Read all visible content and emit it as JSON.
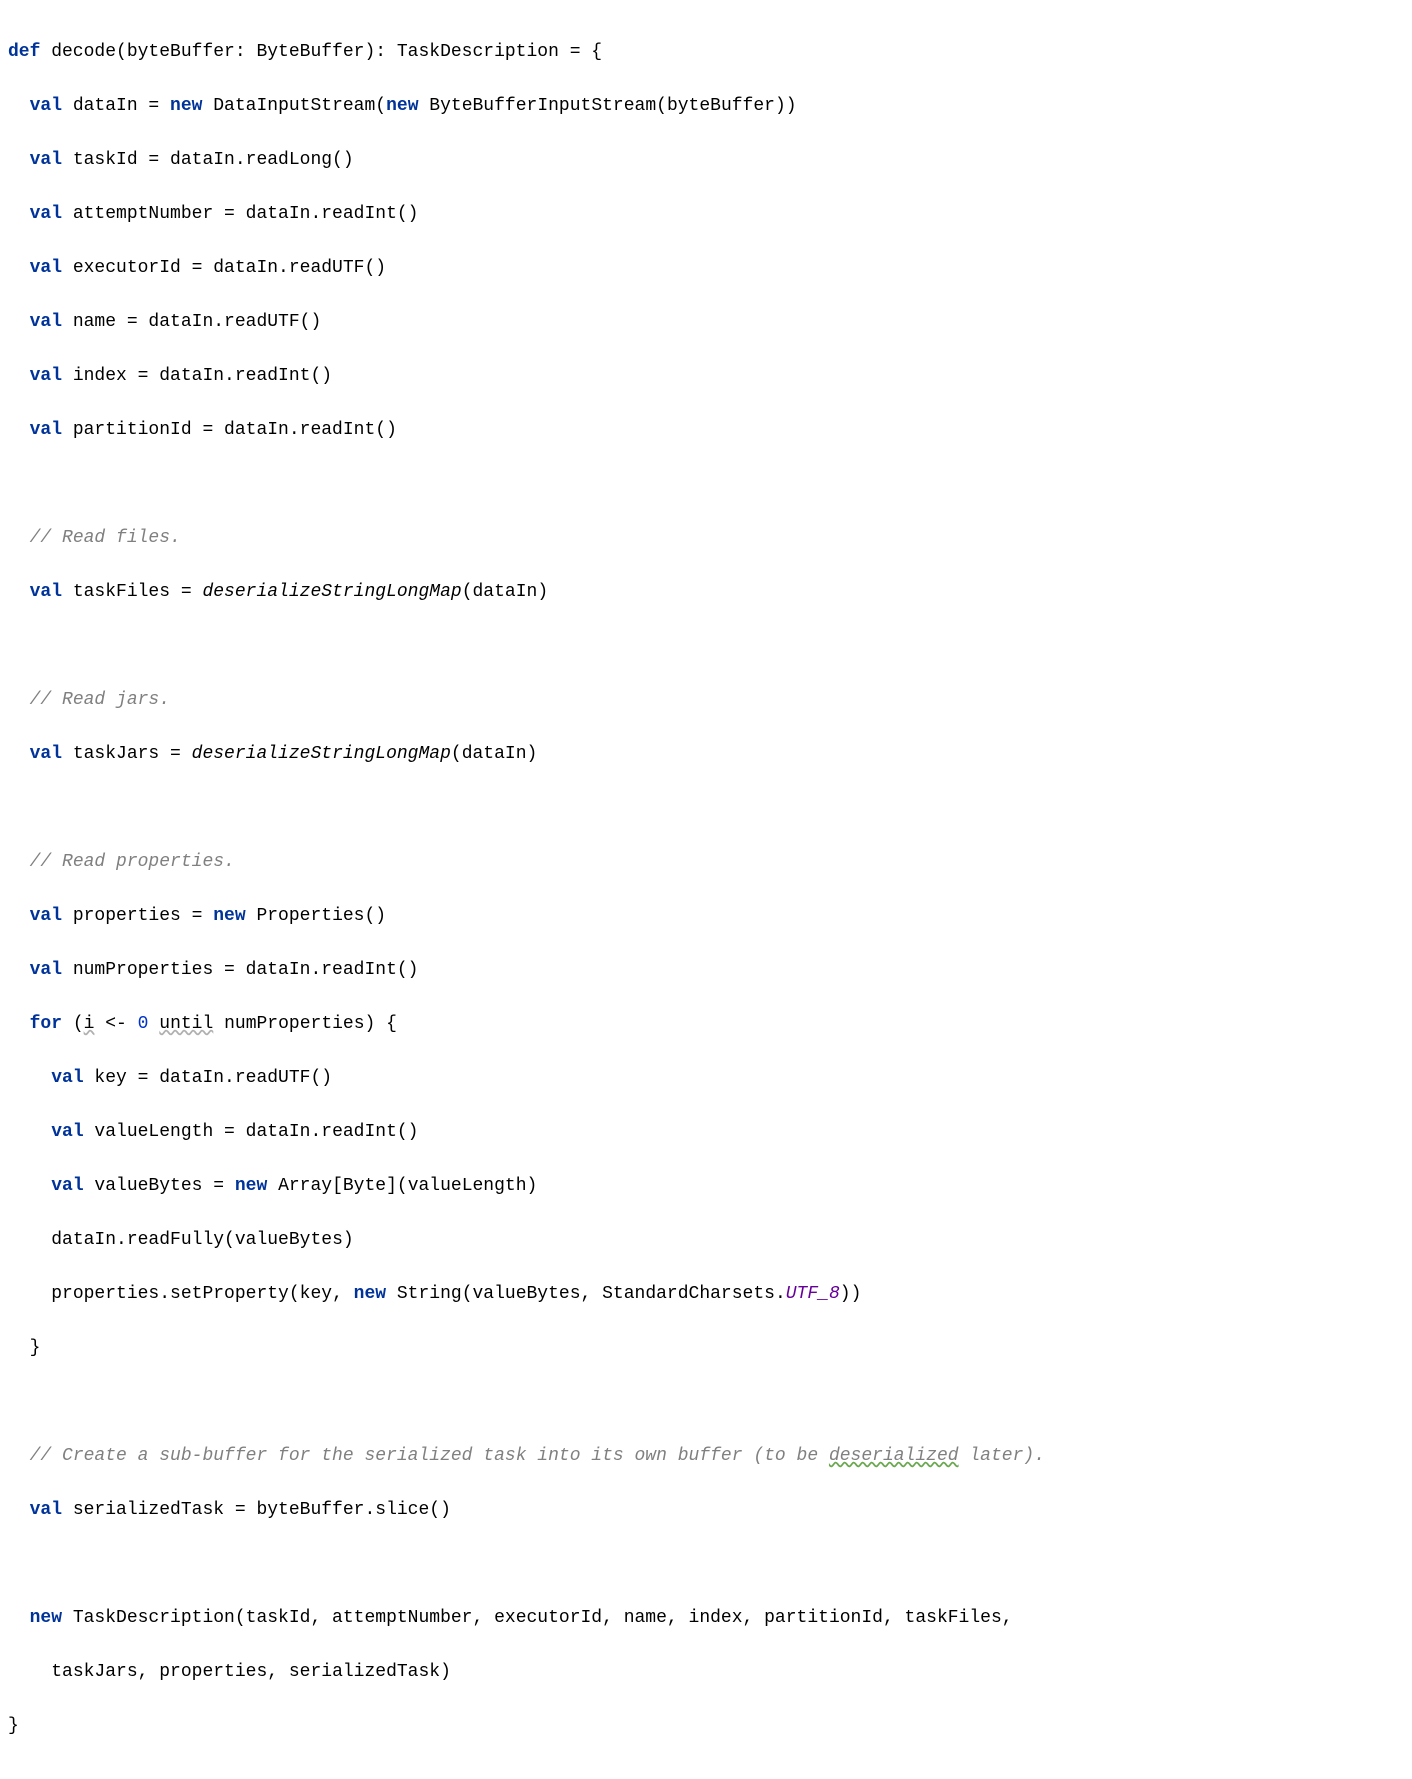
{
  "code": {
    "l01_def": "def",
    "l01_rest": " decode(byteBuffer: ByteBuffer): TaskDescription = {",
    "l02_val": "val",
    "l02_a": " dataIn = ",
    "l02_new1": "new",
    "l02_b": " DataInputStream(",
    "l02_new2": "new",
    "l02_c": " ByteBufferInputStream(byteBuffer))",
    "l03_val": "val",
    "l03_rest": " taskId = dataIn.readLong()",
    "l04_val": "val",
    "l04_rest": " attemptNumber = dataIn.readInt()",
    "l05_val": "val",
    "l05_rest": " executorId = dataIn.readUTF()",
    "l06_val": "val",
    "l06_rest": " name = dataIn.readUTF()",
    "l07_val": "val",
    "l07_rest": " index = dataIn.readInt()",
    "l08_val": "val",
    "l08_rest": " partitionId = dataIn.readInt()",
    "l10_comment": "// Read files.",
    "l11_val": "val",
    "l11_a": " taskFiles = ",
    "l11_call": "deserializeStringLongMap",
    "l11_b": "(dataIn)",
    "l13_comment": "// Read jars.",
    "l14_val": "val",
    "l14_a": " taskJars = ",
    "l14_call": "deserializeStringLongMap",
    "l14_b": "(dataIn)",
    "l16_comment": "// Read properties.",
    "l17_val": "val",
    "l17_a": " properties = ",
    "l17_new": "new",
    "l17_b": " Properties()",
    "l18_val": "val",
    "l18_rest": " numProperties = dataIn.readInt()",
    "l19_for": "for",
    "l19_a": " (",
    "l19_i": "i",
    "l19_b": " <- ",
    "l19_zero": "0",
    "l19_c": " ",
    "l19_until": "until",
    "l19_d": " numProperties) {",
    "l20_val": "val",
    "l20_rest": " key = dataIn.readUTF()",
    "l21_val": "val",
    "l21_rest": " valueLength = dataIn.readInt()",
    "l22_val": "val",
    "l22_a": " valueBytes = ",
    "l22_new": "new",
    "l22_b": " Array[Byte](valueLength)",
    "l23_rest": "dataIn.readFully(valueBytes)",
    "l24_a": "properties.setProperty(key, ",
    "l24_new": "new",
    "l24_b": " String(valueBytes, StandardCharsets.",
    "l24_const": "UTF_8",
    "l24_c": "))",
    "l25": "}",
    "l27_a": "// Create a sub-buffer for the serialized task into its own buffer (to be ",
    "l27_word": "deserialized",
    "l27_b": " later).",
    "l28_val": "val",
    "l28_rest": " serializedTask = byteBuffer.slice()",
    "l30_new": "new",
    "l30_rest": " TaskDescription(taskId, attemptNumber, executorId, name, index, partitionId, taskFiles,",
    "l31_rest": "taskJars, properties, serializedTask)",
    "l32": "}"
  }
}
